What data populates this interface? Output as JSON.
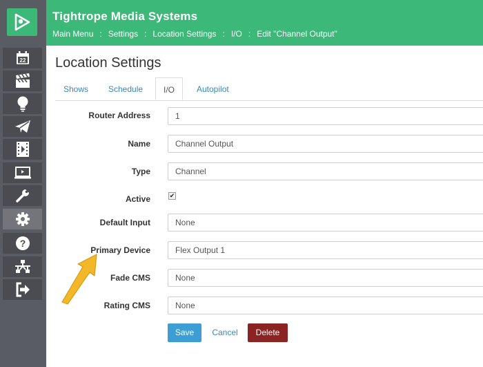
{
  "colors": {
    "header": "#3cb878",
    "sidebar": "#5a5c63",
    "link": "#3a87b8",
    "save": "#3d9ed6",
    "delete": "#8c2323",
    "arrow": "#f2b829"
  },
  "header": {
    "title": "Tightrope Media Systems",
    "breadcrumb": [
      "Main Menu",
      "Settings",
      "Location Settings",
      "I/O",
      "Edit \"Channel Output\""
    ],
    "separator": ":"
  },
  "sidebar": {
    "items": [
      {
        "icon": "calendar-icon",
        "text": "22"
      },
      {
        "icon": "clapperboard-icon"
      },
      {
        "icon": "bulb-icon"
      },
      {
        "icon": "paper-plane-icon"
      },
      {
        "icon": "film-play-icon"
      },
      {
        "icon": "monitor-icon"
      },
      {
        "icon": "wrench-icon"
      },
      {
        "icon": "gear-icon",
        "active": true
      },
      {
        "icon": "help-icon"
      },
      {
        "icon": "network-icon"
      },
      {
        "icon": "sign-out-icon"
      }
    ]
  },
  "page": {
    "title": "Location Settings",
    "tabs": [
      {
        "label": "Shows"
      },
      {
        "label": "Schedule"
      },
      {
        "label": "I/O",
        "active": true
      },
      {
        "label": "Autopilot"
      }
    ]
  },
  "form": {
    "router_address": {
      "label": "Router Address",
      "value": "1"
    },
    "name": {
      "label": "Name",
      "value": "Channel Output"
    },
    "type": {
      "label": "Type",
      "value": "Channel"
    },
    "active": {
      "label": "Active",
      "checked": true,
      "mark": "✔"
    },
    "default_input": {
      "label": "Default Input",
      "value": "None"
    },
    "primary_device": {
      "label": "Primary Device",
      "value": "Flex Output 1"
    },
    "fade_cms": {
      "label": "Fade CMS",
      "value": "None"
    },
    "rating_cms": {
      "label": "Rating CMS",
      "value": "None"
    }
  },
  "buttons": {
    "save": "Save",
    "cancel": "Cancel",
    "delete": "Delete"
  }
}
